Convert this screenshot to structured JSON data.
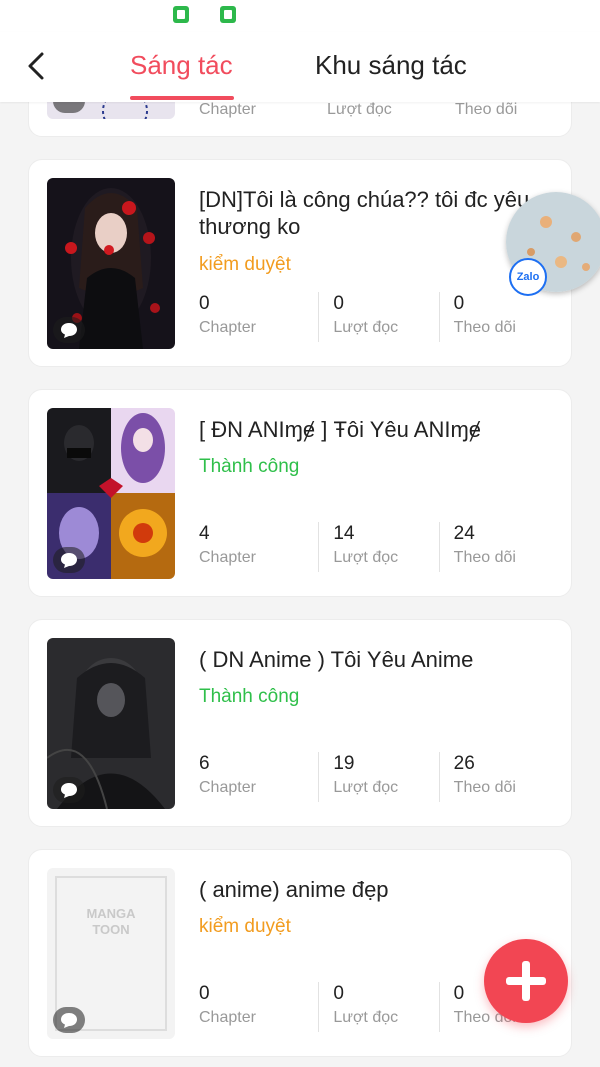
{
  "header": {
    "tabs": [
      {
        "label": "Sáng tác",
        "active": true
      },
      {
        "label": "Khu sáng tác",
        "active": false
      }
    ]
  },
  "partial_card": {
    "labels": [
      "Chapter",
      "Lượt đọc",
      "Theo dõi"
    ]
  },
  "works": [
    {
      "title": "[DN]Tôi là công chúa?? tôi đc yêu thương ko",
      "status": "kiểm duyệt",
      "chapter": "0",
      "reads": "0",
      "follows": "0"
    },
    {
      "title": "[ ĐN ANIɱɇ ] Ŧôi Yêu ANIɱɇ",
      "status": "Thành công",
      "chapter": "4",
      "reads": "14",
      "follows": "24"
    },
    {
      "title": "( DN Anime ) Tôi Yêu Anime",
      "status": "Thành công",
      "chapter": "6",
      "reads": "19",
      "follows": "26"
    },
    {
      "title": "( anime) anime đẹp",
      "status": "kiểm duyệt",
      "chapter": "0",
      "reads": "0",
      "follows": "0"
    }
  ],
  "stat_labels": {
    "chapter": "Chapter",
    "reads": "Lượt đọc",
    "follows": "Theo dõi"
  },
  "placeholder_cover": {
    "line1": "MANGA",
    "line2": "TOON"
  },
  "chat_bubble": {
    "badge": "Zalo"
  },
  "colors": {
    "accent": "#f14c5d",
    "status_review": "#f29c1f",
    "status_success": "#2fbf4a",
    "fab": "#f24653"
  }
}
